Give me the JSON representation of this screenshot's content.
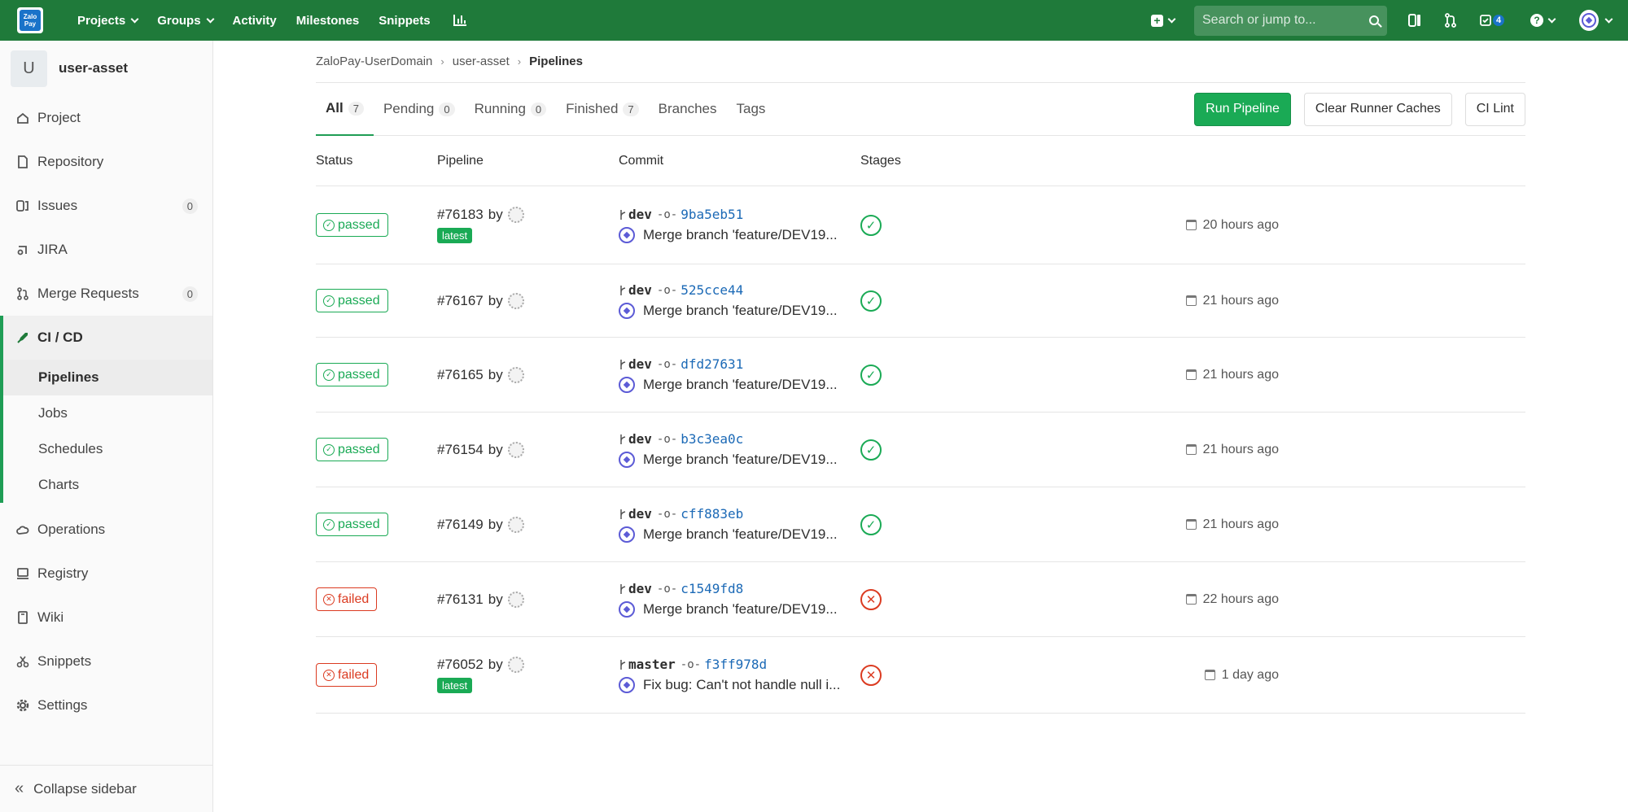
{
  "topnav": {
    "logo_text": "Zalo Pay",
    "links": [
      {
        "label": "Projects",
        "dropdown": true
      },
      {
        "label": "Groups",
        "dropdown": true
      },
      {
        "label": "Activity",
        "dropdown": false
      },
      {
        "label": "Milestones",
        "dropdown": false
      },
      {
        "label": "Snippets",
        "dropdown": false
      }
    ],
    "search_placeholder": "Search or jump to...",
    "todo_count": "4"
  },
  "sidebar": {
    "project_initial": "U",
    "project_name": "user-asset",
    "items": [
      {
        "label": "Project",
        "icon": "home-icon"
      },
      {
        "label": "Repository",
        "icon": "doc-icon"
      },
      {
        "label": "Issues",
        "icon": "issues-icon",
        "count": "0"
      },
      {
        "label": "JIRA",
        "icon": "jira-icon"
      },
      {
        "label": "Merge Requests",
        "icon": "merge-icon",
        "count": "0"
      },
      {
        "label": "CI / CD",
        "icon": "rocket-icon"
      }
    ],
    "cicd_sub": [
      "Pipelines",
      "Jobs",
      "Schedules",
      "Charts"
    ],
    "items_after": [
      {
        "label": "Operations",
        "icon": "cloud-icon"
      },
      {
        "label": "Registry",
        "icon": "registry-icon"
      },
      {
        "label": "Wiki",
        "icon": "book-icon"
      },
      {
        "label": "Snippets",
        "icon": "scissors-icon"
      },
      {
        "label": "Settings",
        "icon": "gear-icon"
      }
    ],
    "collapse_label": "Collapse sidebar"
  },
  "breadcrumb": [
    "ZaloPay-UserDomain",
    "user-asset",
    "Pipelines"
  ],
  "tabs": [
    {
      "label": "All",
      "count": "7"
    },
    {
      "label": "Pending",
      "count": "0"
    },
    {
      "label": "Running",
      "count": "0"
    },
    {
      "label": "Finished",
      "count": "7"
    },
    {
      "label": "Branches",
      "count": null
    },
    {
      "label": "Tags",
      "count": null
    }
  ],
  "buttons": {
    "run": "Run Pipeline",
    "clear": "Clear Runner Caches",
    "lint": "CI Lint"
  },
  "table": {
    "headers": [
      "Status",
      "Pipeline",
      "Commit",
      "Stages"
    ],
    "rows": [
      {
        "status": "passed",
        "id": "#76183",
        "by": "by",
        "latest": true,
        "branch": "dev",
        "sha": "9ba5eb51",
        "msg": "Merge branch 'feature/DEV19...",
        "time": "20 hours ago"
      },
      {
        "status": "passed",
        "id": "#76167",
        "by": "by",
        "latest": false,
        "branch": "dev",
        "sha": "525cce44",
        "msg": "Merge branch 'feature/DEV19...",
        "time": "21 hours ago"
      },
      {
        "status": "passed",
        "id": "#76165",
        "by": "by",
        "latest": false,
        "branch": "dev",
        "sha": "dfd27631",
        "msg": "Merge branch 'feature/DEV19...",
        "time": "21 hours ago"
      },
      {
        "status": "passed",
        "id": "#76154",
        "by": "by",
        "latest": false,
        "branch": "dev",
        "sha": "b3c3ea0c",
        "msg": "Merge branch 'feature/DEV19...",
        "time": "21 hours ago"
      },
      {
        "status": "passed",
        "id": "#76149",
        "by": "by",
        "latest": false,
        "branch": "dev",
        "sha": "cff883eb",
        "msg": "Merge branch 'feature/DEV19...",
        "time": "21 hours ago"
      },
      {
        "status": "failed",
        "id": "#76131",
        "by": "by",
        "latest": false,
        "branch": "dev",
        "sha": "c1549fd8",
        "msg": "Merge branch 'feature/DEV19...",
        "time": "22 hours ago"
      },
      {
        "status": "failed",
        "id": "#76052",
        "by": "by",
        "latest": true,
        "branch": "master",
        "sha": "f3ff978d",
        "msg": "Fix bug: Can't not handle null i...",
        "time": "1 day ago"
      }
    ],
    "latest_label": "latest"
  },
  "colors": {
    "nav": "#1f7a3a",
    "success": "#1aaa55",
    "danger": "#db3b21",
    "link": "#1b69b6"
  }
}
